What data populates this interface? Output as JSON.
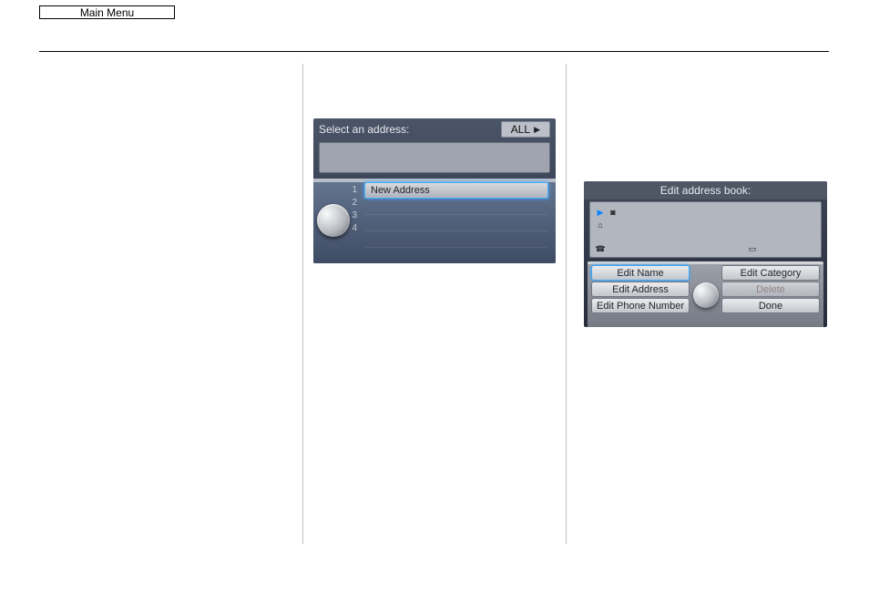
{
  "header": {
    "main_menu_label": "Main Menu"
  },
  "shot1": {
    "title": "Select an address:",
    "filter_label": "ALL",
    "filter_arrow": "▶",
    "row_numbers": [
      "1",
      "2",
      "3",
      "4"
    ],
    "rows": [
      {
        "label": "New Address",
        "selected": true
      },
      {
        "label": "",
        "selected": false
      },
      {
        "label": "",
        "selected": false
      },
      {
        "label": "",
        "selected": false
      }
    ]
  },
  "shot2": {
    "title": "Edit address book:",
    "info_icons": {
      "play": "▶",
      "camera": "◙",
      "house": "⌂",
      "phone": "☎",
      "card": "▭"
    },
    "buttons": {
      "edit_name": "Edit Name",
      "edit_category": "Edit Category",
      "edit_address": "Edit Address",
      "delete": "Delete",
      "edit_phone": "Edit Phone Number",
      "done": "Done"
    }
  }
}
